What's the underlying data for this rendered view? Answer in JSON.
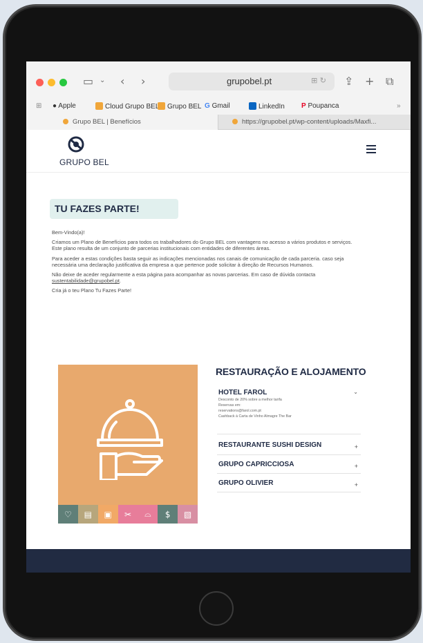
{
  "browser": {
    "url": "grupobel.pt",
    "favorites": [
      {
        "label": "Apple",
        "icon": "apple-icon"
      },
      {
        "label": "Cloud Grupo BEL",
        "icon": "grupo-bel-icon"
      },
      {
        "label": "Grupo BEL",
        "icon": "grupo-bel-icon"
      },
      {
        "label": "Gmail",
        "icon": "google-icon"
      },
      {
        "label": "LinkedIn",
        "icon": "linkedin-icon"
      },
      {
        "label": "Poupanca",
        "icon": "pinterest-icon"
      }
    ],
    "tabs": [
      {
        "label": "Grupo BEL | Benefícios"
      },
      {
        "label": "https://grupobel.pt/wp-content/uploads/Maxfi..."
      }
    ]
  },
  "site": {
    "logo_text": "GRUPO BEL",
    "banner_title": "TU FAZES PARTE!",
    "greeting": "Bem-Vindo(a)!",
    "paragraph_1": "Criamos um Plano de Benefícios para todos os trabalhadores do Grupo BEL com vantagens no acesso a vários produtos e serviços. Este plano resulta de um conjunto de parcerias institucionais com entidades de diferentes áreas.",
    "paragraph_2": "Para aceder a estas condições basta seguir as indicações mencionadas nos canais de comunicação de cada parceria. caso seja necessária uma declaração justificativa da empresa a que pertence pode solicitar à direção de Recursos Humanos.",
    "paragraph_3_prefix": "Não deixe de aceder regularmente a esta página para acompanhar as novas parcerias. Em caso de dúvida contacta ",
    "contact_email": "sustentabilidade@grupobel.pt",
    "paragraph_3_suffix": ".",
    "paragraph_4": "Cria já o teu Plano Tu Fazes Parte!",
    "section_title": "RESTAURAÇÃO E ALOJAMENTO",
    "partners": [
      {
        "name": "HOTEL FAROL",
        "expanded": true,
        "details": [
          "Desconto de 20% sobre a melhor tarifa",
          "Reservas em:",
          "reservations@farol.com.pt",
          "Cashback à Carta de Vinho Almagre The Bar"
        ]
      },
      {
        "name": "RESTAURANTE SUSHI DESIGN",
        "expanded": false
      },
      {
        "name": "GRUPO CAPRICCIOSA",
        "expanded": false
      },
      {
        "name": "GRUPO OLIVIER",
        "expanded": false
      }
    ],
    "category_icons": [
      {
        "icon": "health-icon",
        "color": "#5f7f78"
      },
      {
        "icon": "education-icon",
        "color": "#b7a67c"
      },
      {
        "icon": "hotel-icon",
        "color": "#f1a966"
      },
      {
        "icon": "beauty-icon",
        "color": "#e77d9a"
      },
      {
        "icon": "restaurant-icon",
        "color": "#e77d9a"
      },
      {
        "icon": "finance-icon",
        "color": "#5f7f78"
      },
      {
        "icon": "gift-icon",
        "color": "#d88fa3"
      }
    ]
  },
  "colors": {
    "brand_navy": "#1f2a44",
    "banner_bg": "#e1f0ee",
    "panel_orange": "#e8a96d"
  }
}
